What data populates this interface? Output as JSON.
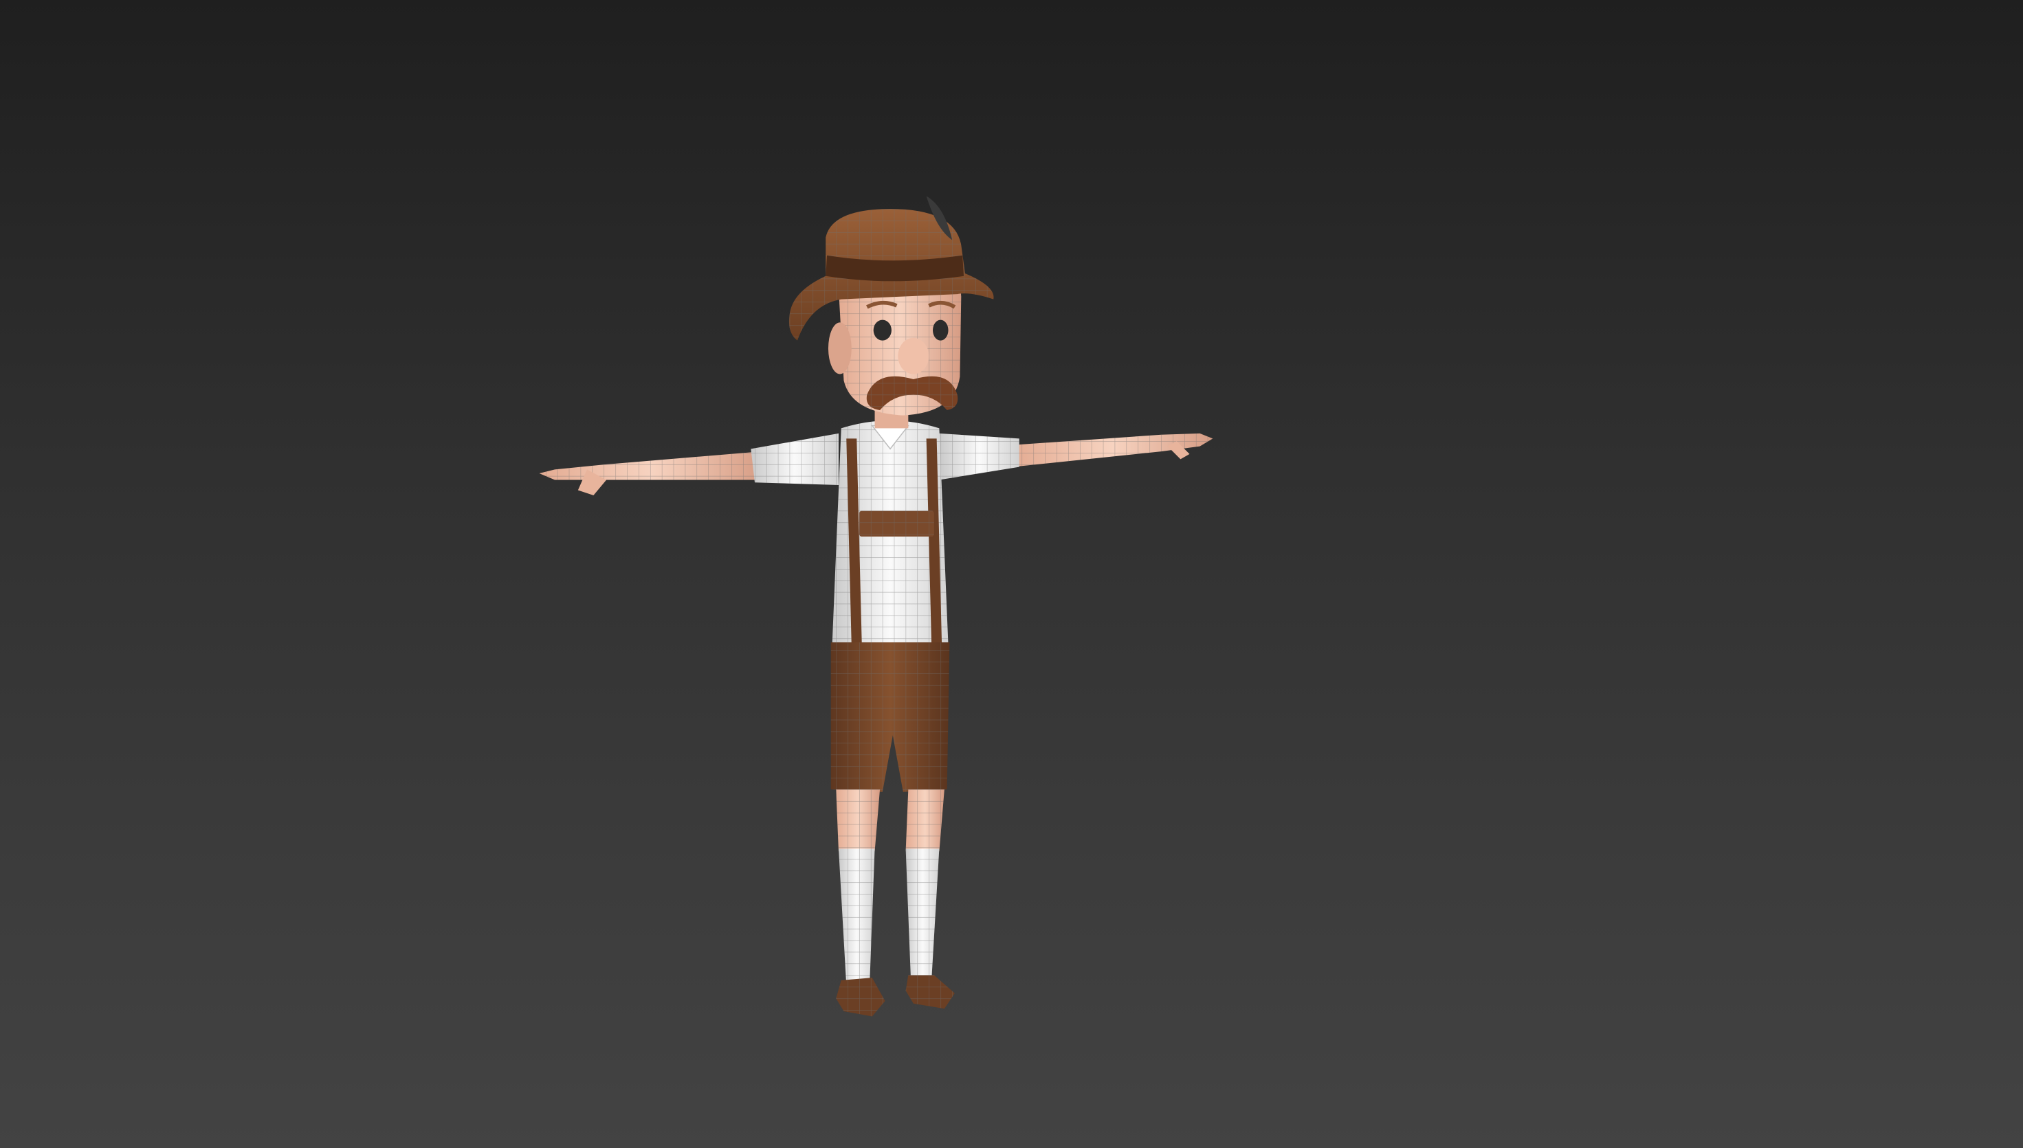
{
  "viewport": {
    "background_top": "#1f1f1f",
    "background_bottom": "#434343"
  },
  "model": {
    "icon": "character-model-icon",
    "colors": {
      "skin": "#f2c5ae",
      "skin_shade": "#d9a48c",
      "shirt": "#f3f3f3",
      "shirt_shade": "#cfcfcf",
      "leather": "#7a4a2c",
      "leather_dark": "#55321d",
      "hat": "#8a5534",
      "hat_band": "#4d2c18",
      "mustache": "#7a4224",
      "eye": "#2c2c2c",
      "wire": "#6f6f6f"
    }
  }
}
